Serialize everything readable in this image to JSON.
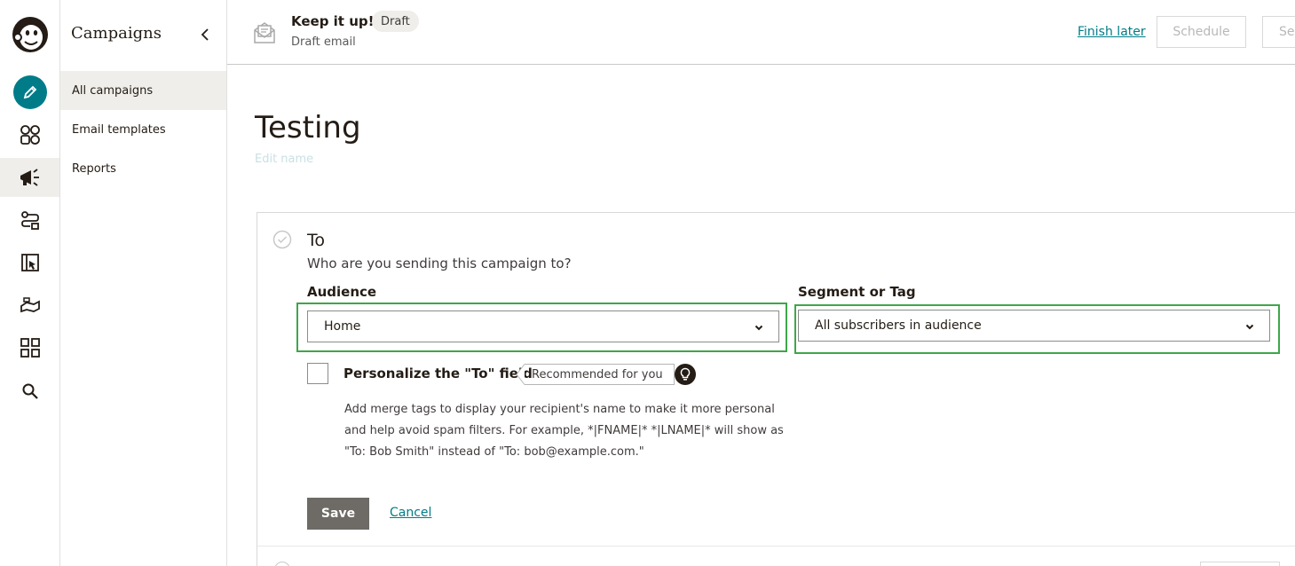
{
  "rail": {
    "items": [
      {
        "name": "logo",
        "icon": "freddie-logo-icon"
      },
      {
        "name": "create",
        "icon": "pencil-icon"
      },
      {
        "name": "audience",
        "icon": "audience-icon"
      },
      {
        "name": "campaigns",
        "icon": "megaphone-icon",
        "active": true
      },
      {
        "name": "automations",
        "icon": "automations-icon"
      },
      {
        "name": "website",
        "icon": "website-icon"
      },
      {
        "name": "content",
        "icon": "content-icon"
      },
      {
        "name": "integrations",
        "icon": "grid-icon"
      },
      {
        "name": "search",
        "icon": "search-icon"
      }
    ]
  },
  "subnav": {
    "title": "Campaigns",
    "items": [
      {
        "label": "All campaigns",
        "active": true
      },
      {
        "label": "Email templates"
      },
      {
        "label": "Reports"
      }
    ]
  },
  "header": {
    "title": "Keep it up!",
    "badge": "Draft",
    "subtitle": "Draft email",
    "finish_later": "Finish later",
    "schedule": "Schedule",
    "send": "Send"
  },
  "page": {
    "title": "Testing",
    "edit_name": "Edit name"
  },
  "to_section": {
    "title": "To",
    "subtitle": "Who are you sending this campaign to?",
    "audience_label": "Audience",
    "audience_value": "Home",
    "segment_label": "Segment or Tag",
    "segment_value": "All subscribers in audience",
    "personalize_label": "Personalize the \"To\" field",
    "recommended": "Recommended for you",
    "help_lines": [
      "Add merge tags to display your recipient's name to make it more personal",
      "and help avoid spam filters. For example, *|FNAME|* *|LNAME|* will show as",
      "\"To: Bob Smith\" instead of \"To: bob@example.com.\""
    ],
    "save": "Save",
    "cancel": "Cancel"
  },
  "colors": {
    "accent": "#007c89",
    "highlight": "#3ea64a",
    "save_button": "#6e6a66"
  }
}
